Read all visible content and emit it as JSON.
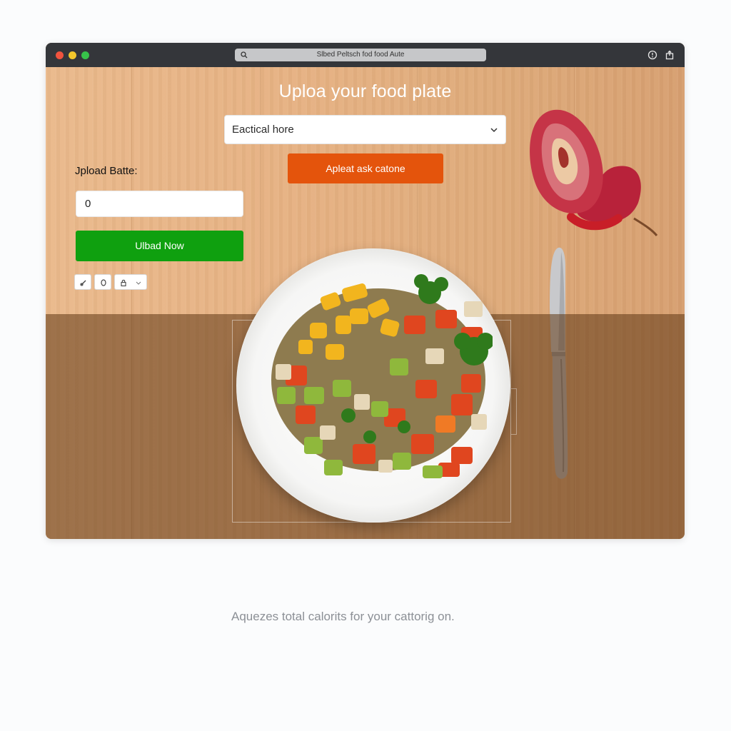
{
  "window": {
    "url_text": "Slbed Peltsch fod food Aute"
  },
  "main": {
    "heading": "Uploa your food plate",
    "dropdown_value": "Eactical hore",
    "orange_button_label": "Apleat ask catone",
    "upload_label": "Jpload Batte:",
    "upload_input_value": "0",
    "green_button_label": "Ulbad Now"
  },
  "caption": "Aquezes total calorits for your cattorig on.",
  "icons": {
    "titlebar": [
      "search-icon",
      "info-icon",
      "share-icon"
    ],
    "toolbar": [
      "pen-icon",
      "circle-icon",
      "lock-icon",
      "chevron-down-icon"
    ]
  },
  "colors": {
    "accent_orange": "#e4540c",
    "accent_green": "#0fa00f",
    "titlebar": "#34363a"
  }
}
